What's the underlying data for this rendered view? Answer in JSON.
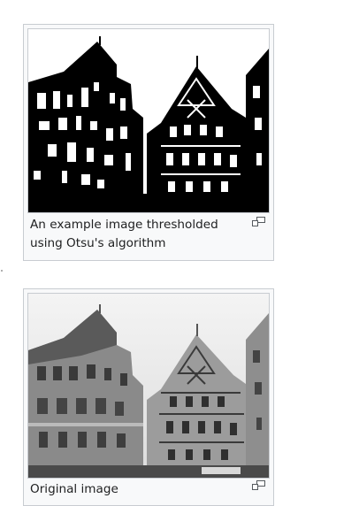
{
  "figures": [
    {
      "caption": "An example image thresholded using Otsu's algorithm",
      "image_kind": "thresholded",
      "enlarge_icon": "enlarge-icon"
    },
    {
      "caption": "Original image",
      "image_kind": "grayscale",
      "enlarge_icon": "enlarge-icon"
    }
  ],
  "colors": {
    "frame_border": "#c8ccd1",
    "frame_bg": "#f8f9fa",
    "caption_text": "#202122"
  }
}
